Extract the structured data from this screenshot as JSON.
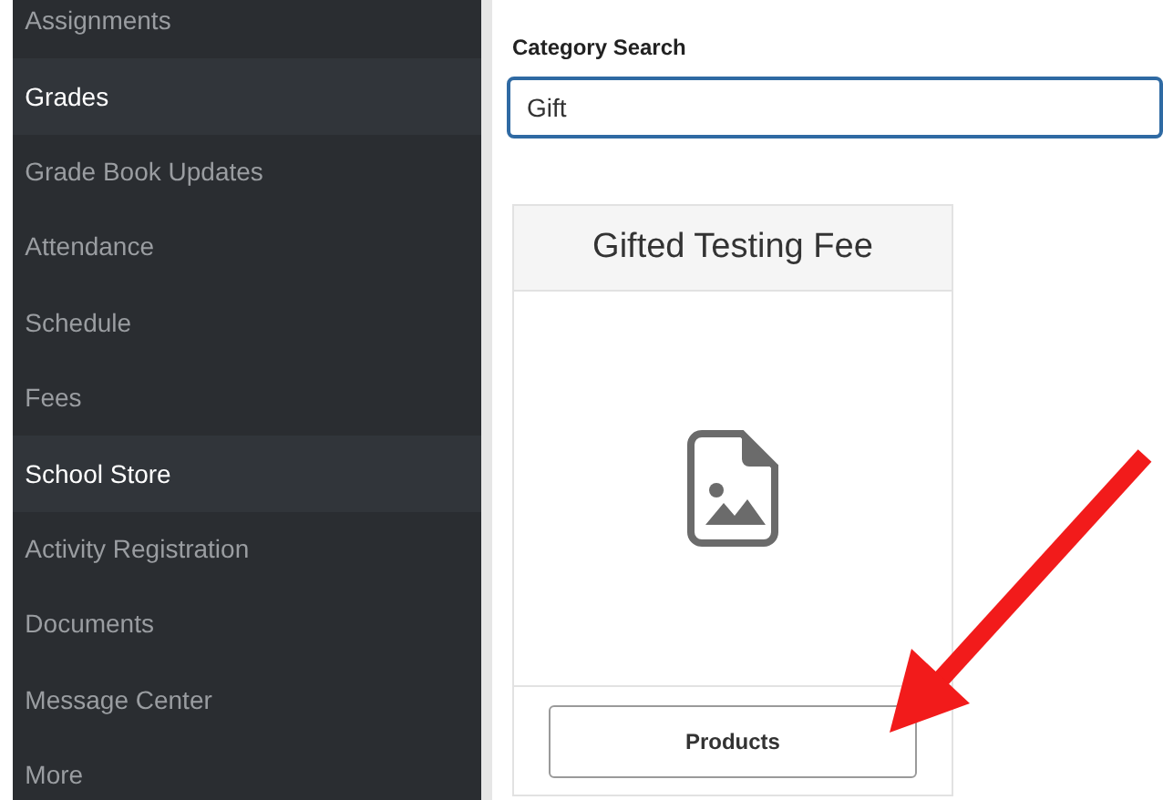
{
  "sidebar": {
    "items": [
      {
        "label": "Assignments",
        "selected": false
      },
      {
        "label": "Grades",
        "selected": true
      },
      {
        "label": "Grade Book Updates",
        "selected": false
      },
      {
        "label": "Attendance",
        "selected": false
      },
      {
        "label": "Schedule",
        "selected": false
      },
      {
        "label": "Fees",
        "selected": false
      },
      {
        "label": "School Store",
        "selected": true
      },
      {
        "label": "Activity Registration",
        "selected": false
      },
      {
        "label": "Documents",
        "selected": false
      },
      {
        "label": "Message Center",
        "selected": false
      },
      {
        "label": "More",
        "selected": false
      }
    ]
  },
  "search": {
    "label": "Category Search",
    "value": "Gift"
  },
  "results": [
    {
      "title": "Gifted Testing Fee",
      "button": "Products"
    }
  ]
}
